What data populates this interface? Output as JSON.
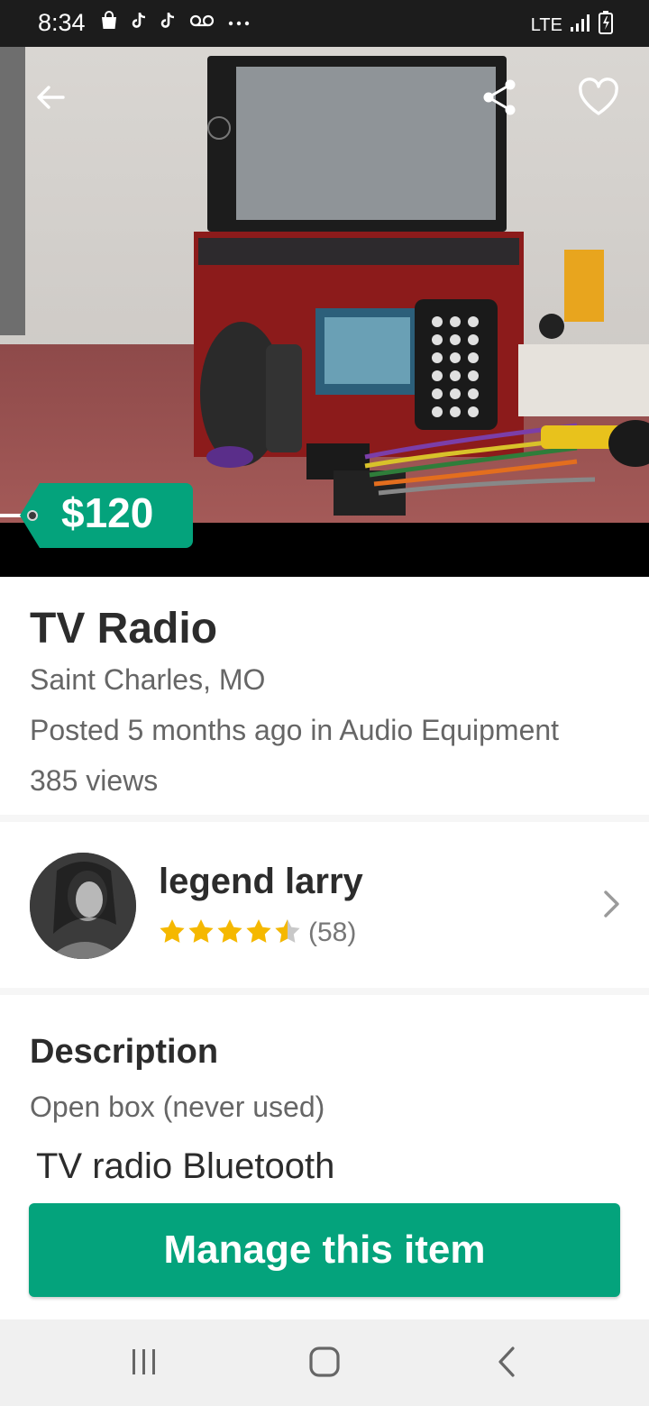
{
  "status_bar": {
    "time": "8:34",
    "network": "LTE",
    "icons": [
      "bag-icon",
      "tiktok-icon",
      "tiktok-icon",
      "voicemail-icon",
      "more-icon"
    ]
  },
  "hero": {
    "image_description": "car stereo",
    "price": "$120"
  },
  "listing": {
    "title": "TV Radio",
    "location": "Saint Charles, MO",
    "posted": "Posted 5 months ago in Audio Equipment",
    "views": "385 views"
  },
  "seller": {
    "name": "legend larry",
    "rating": 4.5,
    "rating_count": "(58)"
  },
  "description": {
    "heading": "Description",
    "condition": "Open box (never used)",
    "text": "TV radio Bluetooth"
  },
  "actions": {
    "manage_label": "Manage this item"
  },
  "colors": {
    "accent": "#04a37c",
    "star": "#f5b800"
  }
}
